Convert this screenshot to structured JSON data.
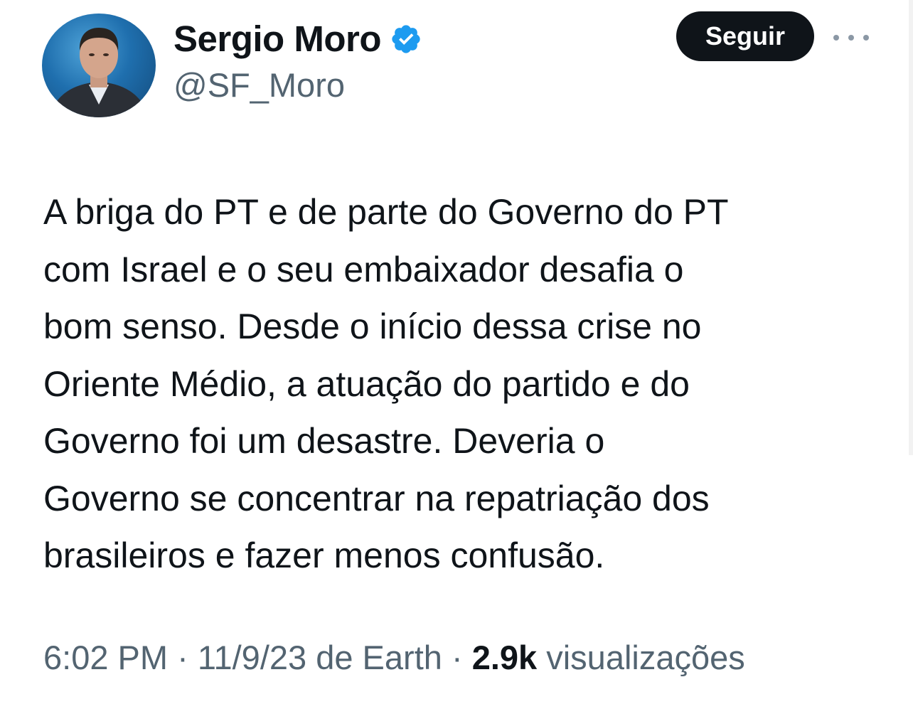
{
  "author": {
    "display_name": "Sergio Moro",
    "handle": "@SF_Moro",
    "verified": true,
    "avatar_icon": "profile-photo"
  },
  "actions": {
    "follow_label": "Seguir",
    "more_icon": "more-horizontal-icon"
  },
  "tweet": {
    "text": "A briga do PT e de parte do Governo do PT\ncom Israel e o seu embaixador desafia o\nbom senso. Desde o início dessa crise no\nOriente Médio, a atuação do partido e do\nGoverno foi um desastre. Deveria o\nGoverno se concentrar na repatriação dos\nbrasileiros e fazer menos confusão."
  },
  "meta": {
    "time": "6:02 PM",
    "separator": "·",
    "date": "11/9/23",
    "source": "de Earth",
    "views_count": "2.9k",
    "views_label": "visualizações"
  },
  "colors": {
    "text": "#0f1419",
    "secondary": "#536471",
    "verified_blue": "#1d9bf0",
    "button_bg": "#0f1419"
  }
}
